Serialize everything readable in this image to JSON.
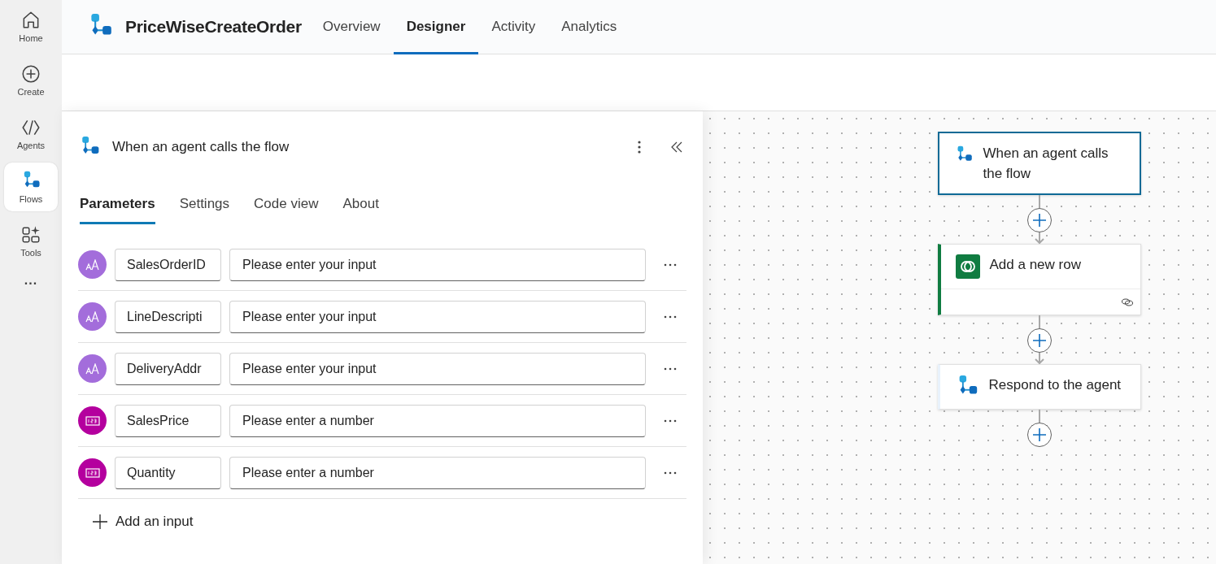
{
  "rail": {
    "items": [
      {
        "label": "Home",
        "kind": "home",
        "selected": false
      },
      {
        "label": "Create",
        "kind": "create",
        "selected": false
      },
      {
        "label": "Agents",
        "kind": "agents",
        "selected": false
      },
      {
        "label": "Flows",
        "kind": "flows",
        "selected": true
      },
      {
        "label": "Tools",
        "kind": "tools",
        "selected": false
      }
    ],
    "more": "..."
  },
  "header": {
    "title": "PriceWiseCreateOrder",
    "tabs": [
      {
        "label": "Overview",
        "selected": false
      },
      {
        "label": "Designer",
        "selected": true
      },
      {
        "label": "Activity",
        "selected": false
      },
      {
        "label": "Analytics",
        "selected": false
      }
    ]
  },
  "panel": {
    "title": "When an agent calls the flow",
    "tabs": [
      {
        "label": "Parameters",
        "selected": true
      },
      {
        "label": "Settings",
        "selected": false
      },
      {
        "label": "Code view",
        "selected": false
      },
      {
        "label": "About",
        "selected": false
      }
    ],
    "inputs": [
      {
        "kind": "text",
        "name": "SalesOrderID",
        "placeholder": "Please enter your input"
      },
      {
        "kind": "text",
        "name": "LineDescripti",
        "placeholder": "Please enter your input"
      },
      {
        "kind": "text",
        "name": "DeliveryAddr",
        "placeholder": "Please enter your input"
      },
      {
        "kind": "number",
        "name": "SalesPrice",
        "placeholder": "Please enter a number"
      },
      {
        "kind": "number",
        "name": "Quantity",
        "placeholder": "Please enter a number"
      }
    ],
    "add_label": "Add an input"
  },
  "canvas": {
    "nodes": [
      {
        "kind": "trigger",
        "title": "When an agent calls the flow",
        "selected": true
      },
      {
        "kind": "dataverse",
        "title": "Add a new row",
        "selected": false
      },
      {
        "kind": "respond",
        "title": "Respond to the agent",
        "selected": false
      }
    ]
  }
}
